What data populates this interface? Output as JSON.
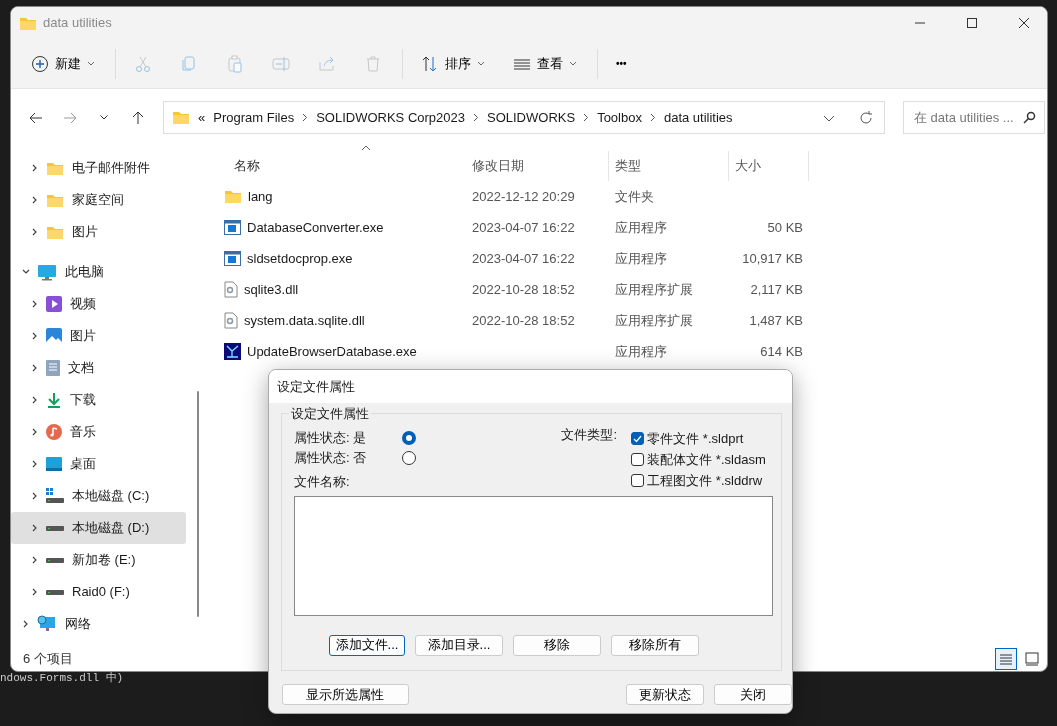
{
  "background_text": "ndows.Forms.dll 中)",
  "window": {
    "title": "data utilities"
  },
  "toolbar": [
    {
      "kind": "new",
      "label": "新建",
      "disabled": false
    },
    {
      "kind": "cut",
      "disabled": true
    },
    {
      "kind": "copy",
      "disabled": true
    },
    {
      "kind": "paste",
      "disabled": true
    },
    {
      "kind": "rename",
      "disabled": true
    },
    {
      "kind": "share",
      "disabled": true
    },
    {
      "kind": "delete",
      "disabled": true
    },
    {
      "kind": "sort",
      "label": "排序",
      "disabled": false
    },
    {
      "kind": "view",
      "label": "查看",
      "disabled": false
    },
    {
      "kind": "more",
      "label": "•••",
      "disabled": false
    }
  ],
  "address": {
    "overflow": "«",
    "breadcrumb": [
      "Program Files",
      "SOLIDWORKS Corp2023",
      "SOLIDWORKS",
      "Toolbox",
      "data utilities"
    ]
  },
  "search": {
    "placeholder": "在 data utilities ..."
  },
  "sidebar": {
    "items": [
      {
        "label": "电子邮件附件",
        "kind": "folder",
        "selected": false
      },
      {
        "label": "家庭空间",
        "kind": "folder",
        "selected": false
      },
      {
        "label": "图片",
        "kind": "folder",
        "selected": false
      },
      {
        "label": "此电脑",
        "kind": "computer",
        "selected": false,
        "expanded": true,
        "children": [
          {
            "label": "视频",
            "kind": "video",
            "selected": false
          },
          {
            "label": "图片",
            "kind": "pictures",
            "selected": false
          },
          {
            "label": "文档",
            "kind": "documents",
            "selected": false
          },
          {
            "label": "下载",
            "kind": "download",
            "selected": false
          },
          {
            "label": "音乐",
            "kind": "music",
            "selected": false
          },
          {
            "label": "桌面",
            "kind": "desktop",
            "selected": false
          },
          {
            "label": "本地磁盘 (C:)",
            "kind": "systemdrive",
            "selected": false
          },
          {
            "label": "本地磁盘 (D:)",
            "kind": "drive",
            "selected": true
          },
          {
            "label": "新加卷 (E:)",
            "kind": "drive",
            "selected": false
          },
          {
            "label": "Raid0 (F:)",
            "kind": "drive",
            "selected": false
          }
        ]
      },
      {
        "label": "网络",
        "kind": "network",
        "selected": false,
        "expanded": false
      }
    ]
  },
  "table": {
    "columns": [
      {
        "label": "名称",
        "sorted": true
      },
      {
        "label": "修改日期",
        "sorted": false
      },
      {
        "label": "类型",
        "sorted": false
      },
      {
        "label": "大小",
        "sorted": false
      }
    ],
    "rows": [
      {
        "kind": "folder",
        "name": "lang",
        "date": "2022-12-12 20:29",
        "type": "文件夹"
      },
      {
        "kind": "exe",
        "name": "DatabaseConverter.exe",
        "date": "2023-04-07 16:22",
        "type": "应用程序",
        "size": "50 KB"
      },
      {
        "kind": "exe",
        "name": "sldsetdocprop.exe",
        "date": "2023-04-07 16:22",
        "type": "应用程序",
        "size": "10,917 KB"
      },
      {
        "kind": "dll",
        "name": "sqlite3.dll",
        "date": "2022-10-28 18:52",
        "type": "应用程序扩展",
        "size": "2,117 KB"
      },
      {
        "kind": "dll",
        "name": "system.data.sqlite.dll",
        "date": "2022-10-28 18:52",
        "type": "应用程序扩展",
        "size": "1,487 KB"
      },
      {
        "kind": "app",
        "name": "UpdateBrowserDatabase.exe",
        "type": "应用程序",
        "size": "614 KB"
      }
    ]
  },
  "status_bar": {
    "count": "6 个项目",
    "views": [
      {
        "kind": "details",
        "selected": true
      },
      {
        "kind": "tiles",
        "selected": false
      }
    ]
  },
  "dialog": {
    "title": "设定文件属性",
    "group": "设定文件属性",
    "radios": [
      {
        "label": "属性状态: 是",
        "selected": true
      },
      {
        "label": "属性状态: 否",
        "selected": false
      }
    ],
    "file_type_label": "文件类型:",
    "file_types": [
      {
        "label": "零件文件 *.sldprt",
        "checked": true
      },
      {
        "label": "装配体文件 *.sldasm",
        "checked": false
      },
      {
        "label": "工程图文件 *.slddrw",
        "checked": false
      }
    ],
    "file_name_label": "文件名称:",
    "list_buttons": [
      {
        "label": "添加文件...",
        "focused": true
      },
      {
        "label": "添加目录...",
        "focused": false
      },
      {
        "label": "移除",
        "focused": false
      },
      {
        "label": "移除所有",
        "focused": false
      }
    ],
    "buttons": [
      {
        "label": "显示所选属性"
      },
      {
        "label": "更新状态"
      },
      {
        "label": "关闭"
      }
    ]
  }
}
